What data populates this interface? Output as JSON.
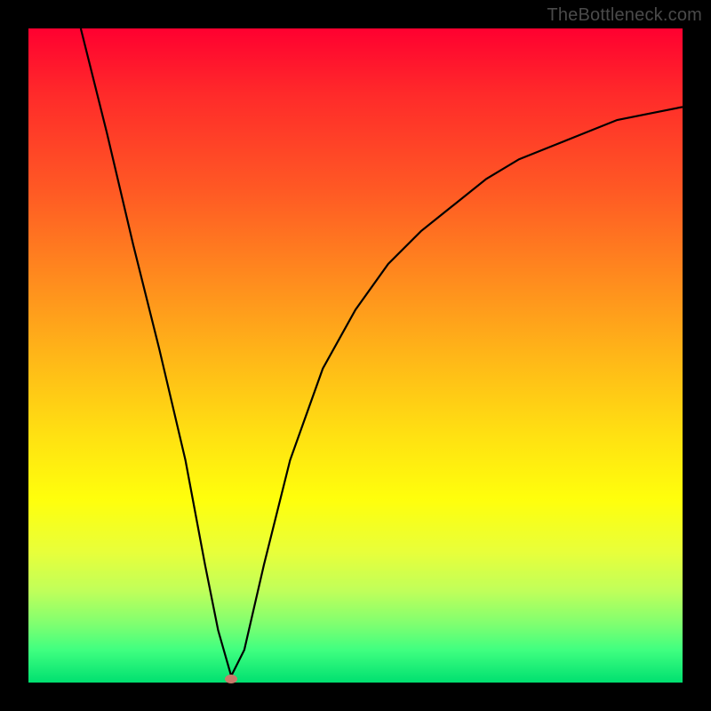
{
  "watermark": "TheBottleneck.com",
  "chart_data": {
    "type": "line",
    "title": "",
    "xlabel": "",
    "ylabel": "",
    "xlim": [
      0,
      100
    ],
    "ylim": [
      0,
      100
    ],
    "background": "rainbow-gradient",
    "series": [
      {
        "name": "curve",
        "x": [
          8,
          12,
          16,
          20,
          24,
          27,
          29,
          31,
          33,
          36,
          40,
          45,
          50,
          55,
          60,
          65,
          70,
          75,
          80,
          85,
          90,
          95,
          100
        ],
        "y": [
          100,
          84,
          67,
          51,
          34,
          18,
          8,
          1,
          5,
          18,
          34,
          48,
          57,
          64,
          69,
          73,
          77,
          80,
          82,
          84,
          86,
          87,
          88
        ]
      }
    ],
    "marker": {
      "x": 31,
      "y": 0.5,
      "color": "#c87a6a"
    }
  }
}
